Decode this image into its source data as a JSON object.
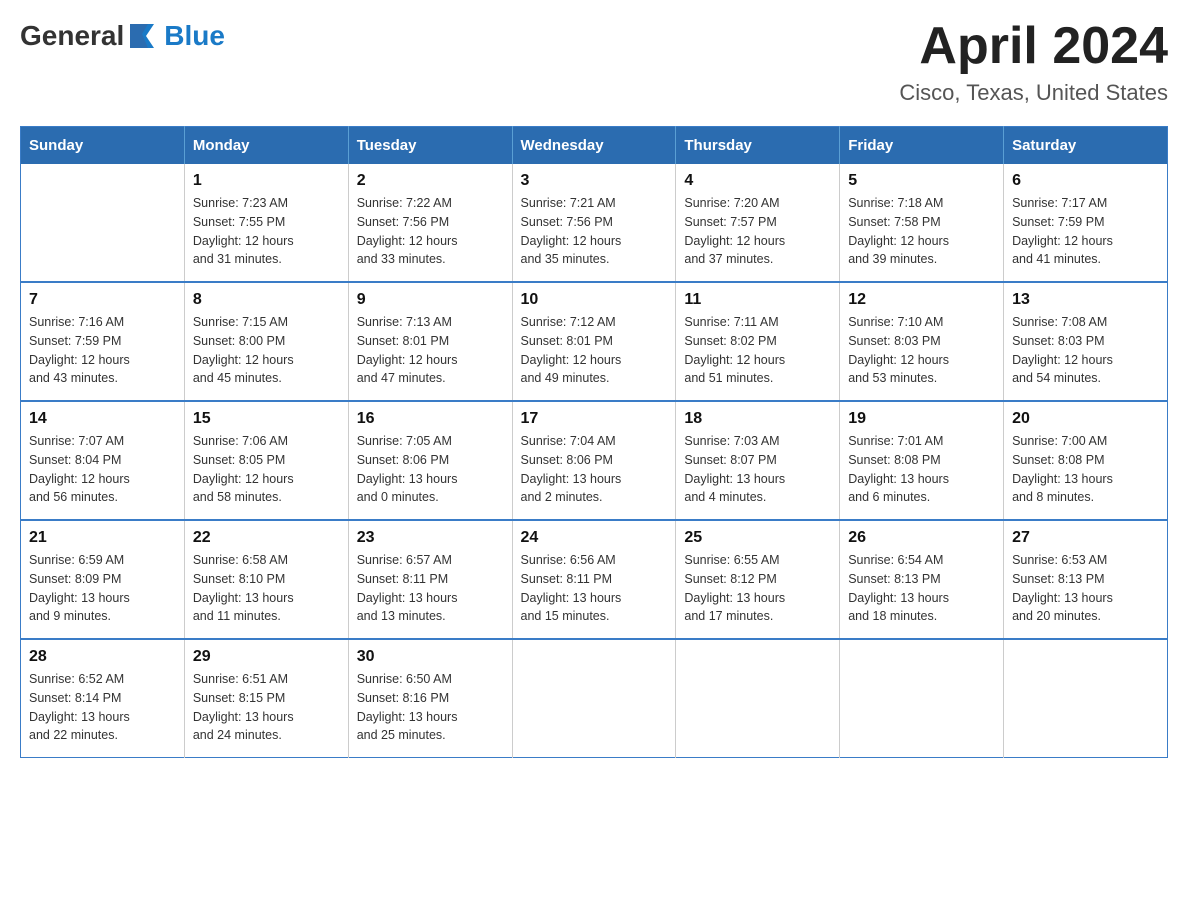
{
  "header": {
    "logo_text_general": "General",
    "logo_text_blue": "Blue",
    "month_year": "April 2024",
    "location": "Cisco, Texas, United States"
  },
  "days_of_week": [
    "Sunday",
    "Monday",
    "Tuesday",
    "Wednesday",
    "Thursday",
    "Friday",
    "Saturday"
  ],
  "weeks": [
    [
      {
        "day": "",
        "info": ""
      },
      {
        "day": "1",
        "info": "Sunrise: 7:23 AM\nSunset: 7:55 PM\nDaylight: 12 hours\nand 31 minutes."
      },
      {
        "day": "2",
        "info": "Sunrise: 7:22 AM\nSunset: 7:56 PM\nDaylight: 12 hours\nand 33 minutes."
      },
      {
        "day": "3",
        "info": "Sunrise: 7:21 AM\nSunset: 7:56 PM\nDaylight: 12 hours\nand 35 minutes."
      },
      {
        "day": "4",
        "info": "Sunrise: 7:20 AM\nSunset: 7:57 PM\nDaylight: 12 hours\nand 37 minutes."
      },
      {
        "day": "5",
        "info": "Sunrise: 7:18 AM\nSunset: 7:58 PM\nDaylight: 12 hours\nand 39 minutes."
      },
      {
        "day": "6",
        "info": "Sunrise: 7:17 AM\nSunset: 7:59 PM\nDaylight: 12 hours\nand 41 minutes."
      }
    ],
    [
      {
        "day": "7",
        "info": "Sunrise: 7:16 AM\nSunset: 7:59 PM\nDaylight: 12 hours\nand 43 minutes."
      },
      {
        "day": "8",
        "info": "Sunrise: 7:15 AM\nSunset: 8:00 PM\nDaylight: 12 hours\nand 45 minutes."
      },
      {
        "day": "9",
        "info": "Sunrise: 7:13 AM\nSunset: 8:01 PM\nDaylight: 12 hours\nand 47 minutes."
      },
      {
        "day": "10",
        "info": "Sunrise: 7:12 AM\nSunset: 8:01 PM\nDaylight: 12 hours\nand 49 minutes."
      },
      {
        "day": "11",
        "info": "Sunrise: 7:11 AM\nSunset: 8:02 PM\nDaylight: 12 hours\nand 51 minutes."
      },
      {
        "day": "12",
        "info": "Sunrise: 7:10 AM\nSunset: 8:03 PM\nDaylight: 12 hours\nand 53 minutes."
      },
      {
        "day": "13",
        "info": "Sunrise: 7:08 AM\nSunset: 8:03 PM\nDaylight: 12 hours\nand 54 minutes."
      }
    ],
    [
      {
        "day": "14",
        "info": "Sunrise: 7:07 AM\nSunset: 8:04 PM\nDaylight: 12 hours\nand 56 minutes."
      },
      {
        "day": "15",
        "info": "Sunrise: 7:06 AM\nSunset: 8:05 PM\nDaylight: 12 hours\nand 58 minutes."
      },
      {
        "day": "16",
        "info": "Sunrise: 7:05 AM\nSunset: 8:06 PM\nDaylight: 13 hours\nand 0 minutes."
      },
      {
        "day": "17",
        "info": "Sunrise: 7:04 AM\nSunset: 8:06 PM\nDaylight: 13 hours\nand 2 minutes."
      },
      {
        "day": "18",
        "info": "Sunrise: 7:03 AM\nSunset: 8:07 PM\nDaylight: 13 hours\nand 4 minutes."
      },
      {
        "day": "19",
        "info": "Sunrise: 7:01 AM\nSunset: 8:08 PM\nDaylight: 13 hours\nand 6 minutes."
      },
      {
        "day": "20",
        "info": "Sunrise: 7:00 AM\nSunset: 8:08 PM\nDaylight: 13 hours\nand 8 minutes."
      }
    ],
    [
      {
        "day": "21",
        "info": "Sunrise: 6:59 AM\nSunset: 8:09 PM\nDaylight: 13 hours\nand 9 minutes."
      },
      {
        "day": "22",
        "info": "Sunrise: 6:58 AM\nSunset: 8:10 PM\nDaylight: 13 hours\nand 11 minutes."
      },
      {
        "day": "23",
        "info": "Sunrise: 6:57 AM\nSunset: 8:11 PM\nDaylight: 13 hours\nand 13 minutes."
      },
      {
        "day": "24",
        "info": "Sunrise: 6:56 AM\nSunset: 8:11 PM\nDaylight: 13 hours\nand 15 minutes."
      },
      {
        "day": "25",
        "info": "Sunrise: 6:55 AM\nSunset: 8:12 PM\nDaylight: 13 hours\nand 17 minutes."
      },
      {
        "day": "26",
        "info": "Sunrise: 6:54 AM\nSunset: 8:13 PM\nDaylight: 13 hours\nand 18 minutes."
      },
      {
        "day": "27",
        "info": "Sunrise: 6:53 AM\nSunset: 8:13 PM\nDaylight: 13 hours\nand 20 minutes."
      }
    ],
    [
      {
        "day": "28",
        "info": "Sunrise: 6:52 AM\nSunset: 8:14 PM\nDaylight: 13 hours\nand 22 minutes."
      },
      {
        "day": "29",
        "info": "Sunrise: 6:51 AM\nSunset: 8:15 PM\nDaylight: 13 hours\nand 24 minutes."
      },
      {
        "day": "30",
        "info": "Sunrise: 6:50 AM\nSunset: 8:16 PM\nDaylight: 13 hours\nand 25 minutes."
      },
      {
        "day": "",
        "info": ""
      },
      {
        "day": "",
        "info": ""
      },
      {
        "day": "",
        "info": ""
      },
      {
        "day": "",
        "info": ""
      }
    ]
  ]
}
